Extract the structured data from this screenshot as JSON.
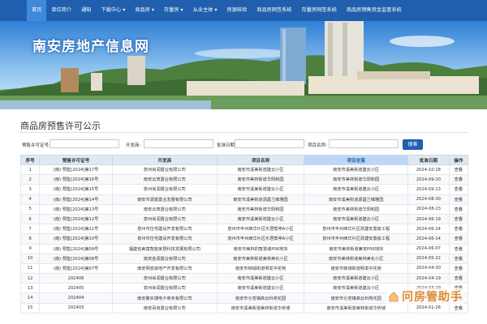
{
  "nav": [
    {
      "label": "首页",
      "active": true
    },
    {
      "label": "单位简介",
      "active": false
    },
    {
      "label": "通知",
      "active": false
    },
    {
      "label": "下载中心 ▾",
      "active": false
    },
    {
      "label": "商品房 ▾",
      "active": false
    },
    {
      "label": "存量房 ▾",
      "active": false
    },
    {
      "label": "从业主体 ▾",
      "active": false
    },
    {
      "label": "房源核验",
      "active": false
    },
    {
      "label": "商品房网签系统",
      "active": false
    },
    {
      "label": "存量房网签系统",
      "active": false
    },
    {
      "label": "商品房销售资金监管系统",
      "active": false
    }
  ],
  "banner": {
    "title": "南安房地产信息网"
  },
  "page": {
    "title": "商品房预售许可公示"
  },
  "search": {
    "permit_label": "预售许可证号:",
    "developer_label": "开发商:",
    "approval_date_label": "批准日期:",
    "project_label": "项目名称:",
    "button": "搜索"
  },
  "table": {
    "headers": [
      "序号",
      "预售许可证号",
      "开发商",
      "项目名称",
      "项目坐落",
      "批准日期",
      "操作"
    ],
    "rows": [
      [
        "1",
        "(南) 预售[2024]第17号",
        "泉州尚润置业有限公司",
        "南安市溪美街道建云小区",
        "南安市溪美街道建云小区",
        "2024-10-18",
        "查看"
      ],
      [
        "2",
        "(南) 预售[2024]第16号",
        "南安云筑置业有限公司",
        "南安市美林街道华阳和园",
        "南安市美林街道华阳和园",
        "2024-09-20",
        "查看"
      ],
      [
        "3",
        "(南) 预售[2024]第15号",
        "泉州尚润置业有限公司",
        "南安市溪美街道建云小区",
        "南安市溪美街道建云小区",
        "2024-09-13",
        "查看"
      ],
      [
        "4",
        "(南) 预售[2024]第14号",
        "南安市源富置业发展有限公司",
        "南安市溪美街道源昌兰峰雅园",
        "南安市溪美街道源昌兰峰雅园",
        "2024-08-30",
        "查看"
      ],
      [
        "5",
        "(南) 预售[2024]第13号",
        "南安云筑置业有限公司",
        "南安市美林街道华阳和园",
        "南安市美林街道华阳和园",
        "2024-08-23",
        "查看"
      ],
      [
        "6",
        "(南) 预售[2024]第12号",
        "泉州尚润置业有限公司",
        "南安市溪美街道建云小区",
        "南安市溪美街道建云小区",
        "2024-06-19",
        "查看"
      ],
      [
        "7",
        "(南) 预售[2024]第11号",
        "泉州市住宅建设开发有限公司",
        "泉州市丰州西华片区乐居帮亭A小区",
        "泉州市丰州西华片区改建安置房工程",
        "2024-06-14",
        "查看"
      ],
      [
        "8",
        "(南) 预售[2024]第10号",
        "泉州市住宅建设开发有限公司",
        "泉州市丰州西华片区乐居帮亭A小区",
        "泉州市丰州西华片区改建安置房工程",
        "2024-06-14",
        "查看"
      ],
      [
        "9",
        "(南) 预售[2024]第09号",
        "福建省美富智能家居科技发展有限公司",
        "南安市美林的智慧城P06地块",
        "南安市美林街道兼安P06地块",
        "2024-06-07",
        "查看"
      ],
      [
        "10",
        "(南) 预售[2024]第08号",
        "南安金源置业有限公司",
        "南安市美林街道美林美化小区",
        "南安市美林街道美林美化小区",
        "2024-05-22",
        "查看"
      ],
      [
        "11",
        "(南) 预售[2024]第07号",
        "南安明发房地产开发有限公司",
        "南安市柳城街道明发中花苑",
        "南安市柳城街道明发中花苑",
        "2024-04-30",
        "查看"
      ],
      [
        "12",
        "202406",
        "泉州尚润置业有限公司",
        "南安市溪美街道建云小区",
        "南安市溪美街道建云小区",
        "2024-04-19",
        "查看"
      ],
      [
        "13",
        "202405",
        "泉州尚润置业有限公司",
        "南安市溪美街道建云小区",
        "南安市溪美街道建云小区",
        "2024-03-29",
        "查看"
      ],
      [
        "14",
        "202404",
        "南安聚实博电子商务有限公司",
        "南安市仑苍镇高云科苑花园",
        "南安市仑苍镇高云科苑花园",
        "2024-03-15",
        "查看"
      ],
      [
        "15",
        "202403",
        "南安百信置业有限公司",
        "南安市溪美街道美林街道华侨城",
        "南安市溪美街道美林街道华侨城",
        "2024-01-26",
        "查看"
      ]
    ]
  },
  "watermark": {
    "text": "问房管助手"
  }
}
